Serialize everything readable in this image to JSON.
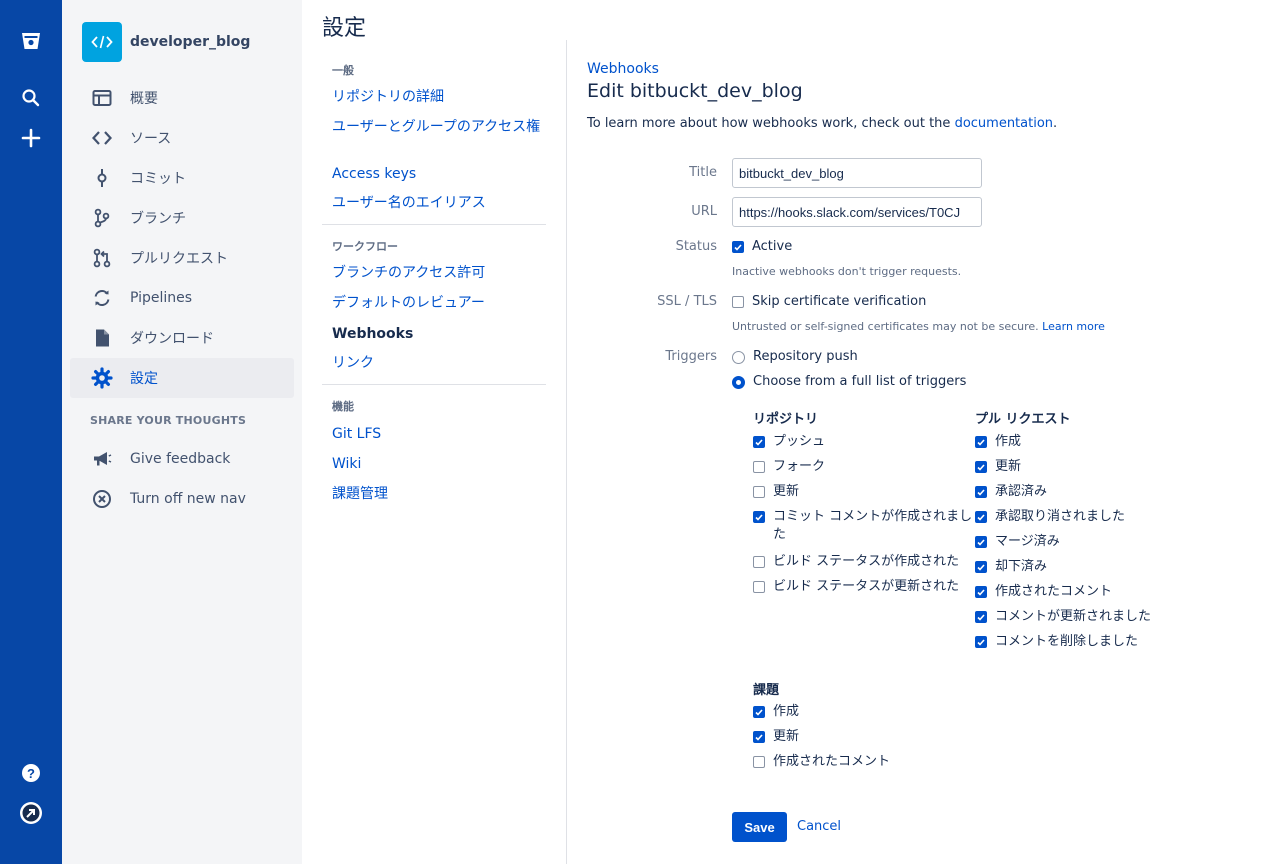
{
  "page_title": "設定",
  "repo": {
    "name": "developer_blog"
  },
  "sidebar": {
    "items": [
      {
        "label": "概要"
      },
      {
        "label": "ソース"
      },
      {
        "label": "コミット"
      },
      {
        "label": "ブランチ"
      },
      {
        "label": "プルリクエスト"
      },
      {
        "label": "Pipelines"
      },
      {
        "label": "ダウンロード"
      },
      {
        "label": "設定",
        "selected": true
      }
    ],
    "share_heading": "SHARE YOUR THOUGHTS",
    "feedback_label": "Give feedback",
    "turn_off_label": "Turn off new nav"
  },
  "settings_nav": {
    "sections": [
      {
        "heading": "一般",
        "links": [
          "リポジトリの詳細",
          "ユーザーとグループのアクセス権",
          "Access keys",
          "ユーザー名のエイリアス"
        ]
      },
      {
        "heading": "ワークフロー",
        "links": [
          "ブランチのアクセス許可",
          "デフォルトのレビュアー",
          "Webhooks",
          "リンク"
        ]
      },
      {
        "heading": "機能",
        "links": [
          "Git LFS",
          "Wiki",
          "課題管理"
        ]
      }
    ],
    "current": "Webhooks"
  },
  "form": {
    "breadcrumb": "Webhooks",
    "heading": "Edit bitbuckt_dev_blog",
    "intro_text": "To learn more about how webhooks work, check out the ",
    "intro_link": "documentation",
    "intro_end": ".",
    "title_label": "Title",
    "title_value": "bitbuckt_dev_blog",
    "url_label": "URL",
    "url_value": "https://hooks.slack.com/services/T0CJ",
    "status_label": "Status",
    "active_label": "Active",
    "active_checked": true,
    "active_help": "Inactive webhooks don't trigger requests.",
    "ssl_label": "SSL / TLS",
    "skip_label": "Skip certificate verification",
    "skip_checked": false,
    "ssl_help": "Untrusted or self-signed certificates may not be secure.",
    "ssl_help_link": "Learn more",
    "triggers_label": "Triggers",
    "trigger_options": [
      {
        "label": "Repository push",
        "selected": false
      },
      {
        "label": "Choose from a full list of triggers",
        "selected": true
      }
    ],
    "repo_group": {
      "title": "リポジトリ",
      "items": [
        {
          "label": "プッシュ",
          "checked": true
        },
        {
          "label": "フォーク",
          "checked": false
        },
        {
          "label": "更新",
          "checked": false
        },
        {
          "label": "コミット コメントが作成されました",
          "checked": true
        },
        {
          "label": "ビルド ステータスが作成された",
          "checked": false
        },
        {
          "label": "ビルド ステータスが更新された",
          "checked": false
        }
      ]
    },
    "pr_group": {
      "title": "プル リクエスト",
      "items": [
        {
          "label": "作成",
          "checked": true
        },
        {
          "label": "更新",
          "checked": true
        },
        {
          "label": "承認済み",
          "checked": true
        },
        {
          "label": "承認取り消されました",
          "checked": true
        },
        {
          "label": "マージ済み",
          "checked": true
        },
        {
          "label": "却下済み",
          "checked": true
        },
        {
          "label": "作成されたコメント",
          "checked": true
        },
        {
          "label": "コメントが更新されました",
          "checked": true
        },
        {
          "label": "コメントを削除しました",
          "checked": true
        }
      ]
    },
    "issue_group": {
      "title": "課題",
      "items": [
        {
          "label": "作成",
          "checked": true
        },
        {
          "label": "更新",
          "checked": true
        },
        {
          "label": "作成されたコメント",
          "checked": false
        }
      ]
    },
    "save_label": "Save",
    "cancel_label": "Cancel"
  }
}
